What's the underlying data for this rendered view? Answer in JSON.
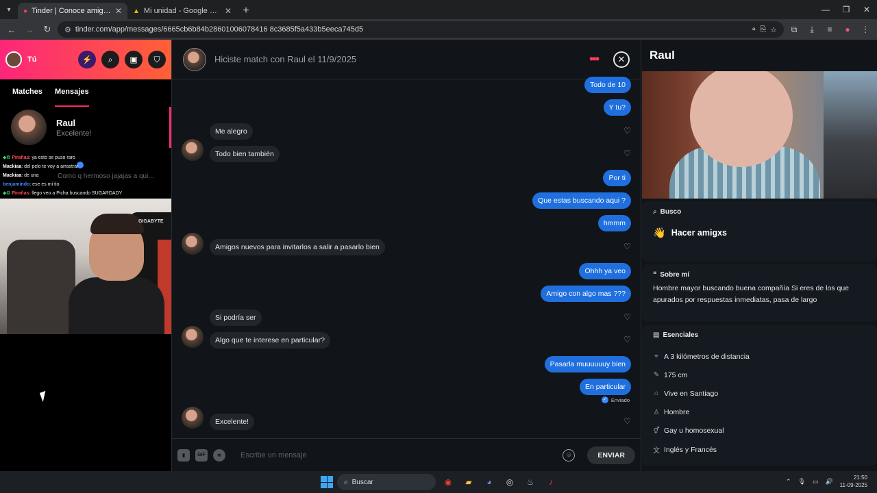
{
  "browser": {
    "tabs": [
      {
        "title": "Tinder | Conoce amigos y gente",
        "active": true
      },
      {
        "title": "Mi unidad - Google Drive",
        "active": false
      }
    ],
    "url": "tinder.com/app/messages/6665cb6b84b28601006078416 8c3685f5a433b5eeca745d5"
  },
  "sidebar": {
    "user_label": "Tú",
    "tabs": [
      "Matches",
      "Mensajes"
    ],
    "conversation": {
      "name": "Raul",
      "last_message": "Excelente!"
    }
  },
  "stream_chat": [
    {
      "nick": "Pirañas",
      "text": ": ya esto se puso raro",
      "color": "#ff4d4d"
    },
    {
      "nick": "Mackiaa",
      "text": ": del pelo te voy a arrastrar",
      "color": "#ffffff"
    },
    {
      "nick": "Mackiaa",
      "text": ": de una",
      "color": "#ffffff"
    },
    {
      "nick": "benjamindo",
      "text": ": ese es mi tio",
      "color": "#3a8bfd"
    },
    {
      "nick": "Pirañas",
      "text": ": llego veo a Picha buscando SUGARDADY",
      "color": "#ff4d4d"
    }
  ],
  "ghost_preview": "Como q hermoso jajajas a qui...",
  "webcam_brand": "GIGABYTE",
  "chat": {
    "header": "Hiciste match con Raul el 11/9/2025",
    "messages": [
      {
        "dir": "out",
        "text": "Todo de 10"
      },
      {
        "dir": "out",
        "text": "Y tu?"
      },
      {
        "dir": "in",
        "text": "Me alegro"
      },
      {
        "dir": "in",
        "text": "Todo bien también"
      },
      {
        "dir": "out",
        "text": "Por ti"
      },
      {
        "dir": "out",
        "text": "Que estas buscando aqui ?"
      },
      {
        "dir": "out",
        "text": "hmmm"
      },
      {
        "dir": "in",
        "text": "Amigos nuevos para invitarlos a salir a pasarlo bien"
      },
      {
        "dir": "out",
        "text": "Ohhh ya veo"
      },
      {
        "dir": "out",
        "text": "Amigo con algo mas ???"
      },
      {
        "dir": "in",
        "text": "Si podría ser"
      },
      {
        "dir": "in",
        "text": "Algo que te interese en particular?"
      },
      {
        "dir": "out",
        "text": "Pasarla muuuuuuy bien"
      },
      {
        "dir": "out",
        "text": "En particular"
      },
      {
        "dir": "in",
        "text": "Excelente!"
      }
    ],
    "sent_status": "Enviado",
    "composer": {
      "placeholder": "Escribe un mensaje",
      "gif_label": "GIF",
      "send_label": "ENVIAR"
    }
  },
  "profile": {
    "name": "Raul",
    "busco_title": "Busco",
    "busco_value": "Hacer amigxs",
    "about_title": "Sobre mí",
    "about_text": "Hombre mayor buscando buena compañía Si eres de los que apurados por respuestas inmediatas, pasa de largo",
    "essentials_title": "Esenciales",
    "essentials": [
      {
        "icon": "location-pin-icon",
        "glyph": "⌖",
        "text": "A 3 kilómetros de distancia"
      },
      {
        "icon": "ruler-icon",
        "glyph": "✎",
        "text": "175 cm"
      },
      {
        "icon": "home-icon",
        "glyph": "⌂",
        "text": "Vive en Santiago"
      },
      {
        "icon": "person-icon",
        "glyph": "♙",
        "text": "Hombre"
      },
      {
        "icon": "orientation-icon",
        "glyph": "⚥",
        "text": "Gay u homosexual"
      },
      {
        "icon": "language-icon",
        "glyph": "文",
        "text": "Inglés y Francés"
      }
    ]
  },
  "taskbar": {
    "search_label": "Buscar",
    "time": "21:50",
    "date": "11-09-2025"
  }
}
